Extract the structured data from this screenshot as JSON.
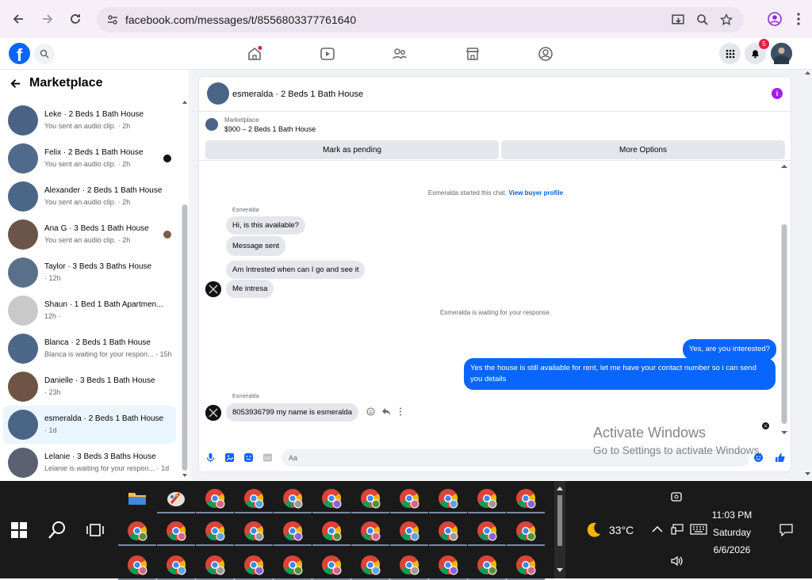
{
  "browser": {
    "url": "facebook.com/messages/t/8556803377761640"
  },
  "fb_header": {
    "logo_letter": "f",
    "notification_count": "5"
  },
  "sidebar": {
    "title": "Marketplace",
    "conversations": [
      {
        "title": "Leke · 2 Beds 1 Bath House",
        "sub": "You sent an audio clip. · 2h",
        "thumb": "#4a6384",
        "dot": ""
      },
      {
        "title": "Felix · 2 Beds 1 Bath House",
        "sub": "You sent an audio clip. · 2h",
        "thumb": "#4f6a8a",
        "dot": "#111111"
      },
      {
        "title": "Alexander · 2 Beds 1 Bath House",
        "sub": "You sent an audio clip. · 2h",
        "thumb": "#4c6688",
        "dot": ""
      },
      {
        "title": "Ana G · 3 Beds 1 Bath House",
        "sub": "You sent an audio clip. · 2h",
        "thumb": "#6b5448",
        "dot": "#7a5c4a"
      },
      {
        "title": "Taylor · 3 Beds 3 Baths House",
        "sub": "· 12h",
        "thumb": "#5a6f8a",
        "dot": ""
      },
      {
        "title": "Shaun · 1 Bed 1 Bath Apartmen...",
        "sub": "12h ·",
        "thumb": "#c9c9c9",
        "dot": ""
      },
      {
        "title": "Blanca · 2 Beds 1 Bath House",
        "sub": "Blanca is waiting for your respon... · 15h",
        "thumb": "#4d6789",
        "dot": ""
      },
      {
        "title": "Danielle · 3 Beds 1 Bath House",
        "sub": "· 23h",
        "thumb": "#6e5444",
        "dot": ""
      },
      {
        "title": "esmeralda · 2 Beds 1 Bath House",
        "sub": "· 1d",
        "thumb": "#4a6486",
        "dot": "",
        "active": true
      },
      {
        "title": "Lelanie · 3 Beds 3 Baths House",
        "sub": "Lelanie is waiting for your respon... · 1d",
        "thumb": "#5b6072",
        "dot": ""
      }
    ]
  },
  "chat": {
    "title": "esmeralda · 2 Beds 1 Bath House",
    "listing_category": "Marketplace",
    "listing_price": "$900 – 2 Beds 1 Bath House",
    "btn_pending": "Mark as pending",
    "btn_more": "More Options",
    "started_text": "Esmeralda started this chat.",
    "view_profile": "View buyer profile",
    "sender_name_1": "Esmeralda",
    "msg_1": "Hi, is this available?",
    "msg_2": "Message sent",
    "msg_3": "Am Intrested  when can I go and see it",
    "msg_4": "Me intresa",
    "waiting_text": "Esmeralda is waiting for your response.",
    "out_1": "Yes, are you interested?",
    "out_2": "Yes the house is still available for rent, let me have your contact number so i can send you details",
    "sender_name_2": "Esmeralda",
    "msg_5": "8053936799 my name is esmeralda",
    "composer_placeholder": "Aa"
  },
  "watermark": {
    "line1": "Activate Windows",
    "line2": "Go to Settings to activate Windows."
  },
  "taskbar": {
    "temperature": "33°C",
    "time": "11:03 PM",
    "day": "Saturday",
    "date": "6/6/2026"
  },
  "colors": {
    "fb_blue": "#0866ff",
    "info_purple": "#a020f0"
  }
}
